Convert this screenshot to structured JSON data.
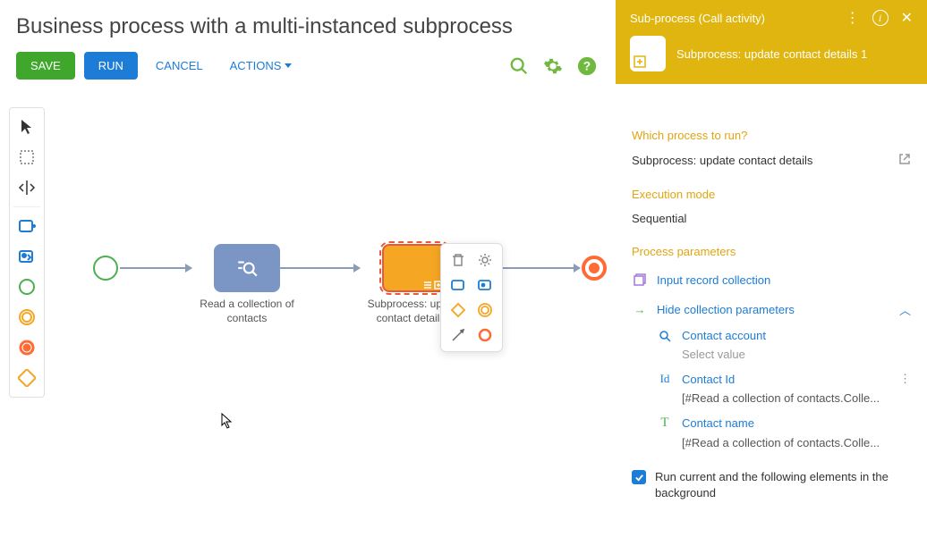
{
  "header": {
    "title": "Business process with a multi-instanced subprocess"
  },
  "toolbar": {
    "save": "SAVE",
    "run": "RUN",
    "cancel": "CANCEL",
    "actions": "ACTIONS"
  },
  "canvas": {
    "nodes": {
      "read": "Read a collection of contacts",
      "subprocess": "Subprocess: update contact details 1"
    }
  },
  "right_panel": {
    "type": "Sub-process (Call activity)",
    "name": "Subprocess: update contact details 1",
    "which_process": {
      "label": "Which process to run?",
      "value": "Subprocess: update contact details"
    },
    "execution_mode": {
      "label": "Execution mode",
      "value": "Sequential"
    },
    "process_parameters": {
      "label": "Process parameters",
      "input_record": "Input record collection",
      "hide_collection": "Hide collection parameters",
      "params": [
        {
          "icon": "search",
          "label": "Contact account",
          "value": "Select value",
          "placeholder": true
        },
        {
          "icon": "id",
          "label": "Contact Id",
          "value": "[#Read a collection of contacts.Colle...",
          "more": true
        },
        {
          "icon": "T",
          "label": "Contact name",
          "value": "[#Read a collection of contacts.Colle..."
        }
      ]
    },
    "run_background": "Run current and the following elements in the background"
  }
}
